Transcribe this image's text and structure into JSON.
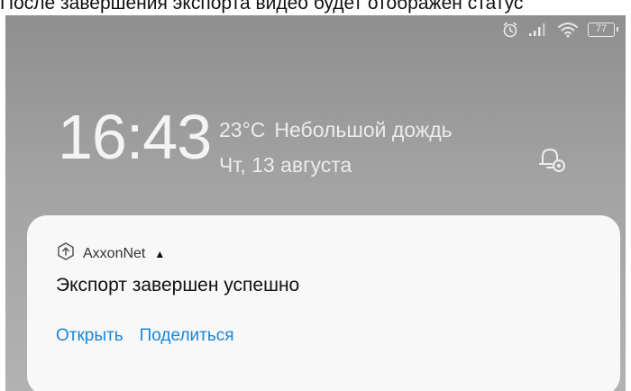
{
  "caption": "После завершения экспорта видео будет отображен статус",
  "status_bar": {
    "icons": [
      "alarm-icon",
      "signal-icon",
      "wifi-icon",
      "battery-icon"
    ],
    "battery_level": "77"
  },
  "lockscreen": {
    "time": "16:43",
    "temperature": "23°C",
    "weather": "Небольшой дождь",
    "date": "Чт, 13 августа"
  },
  "notification": {
    "app_name": "AxxonNet",
    "title": "Экспорт завершен успешно",
    "actions": [
      "Открыть",
      "Поделиться"
    ]
  },
  "colors": {
    "accent": "#1a86d9",
    "card": "#f8f8f8"
  }
}
